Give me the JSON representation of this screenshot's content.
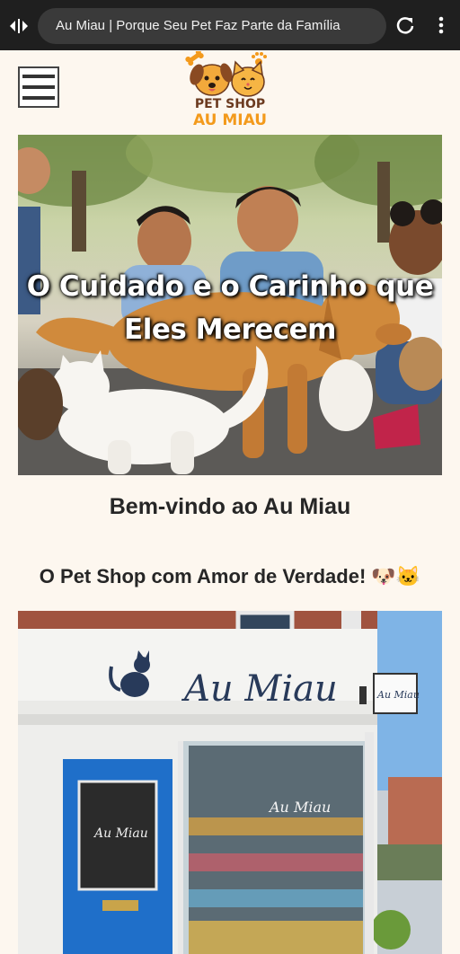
{
  "browser": {
    "url_title": "Au Miau | Porque Seu Pet Faz Parte da Família"
  },
  "logo": {
    "line1": "PET SHOP",
    "line2": "AU MIAU"
  },
  "hero": {
    "title": "O Cuidado e o Carinho que Eles Merecem"
  },
  "welcome": "Bem-vindo ao Au Miau",
  "tagline": "O Pet Shop com Amor de Verdade! 🐶🐱",
  "store": {
    "sign": "Au Miau",
    "hanging_sign": "Au Miau",
    "window_text": "Au Miau",
    "door_text": "Au Miau"
  },
  "colors": {
    "page_bg": "#fdf7ef",
    "door_blue": "#1f6fc9",
    "logo_orange": "#f39a1c"
  }
}
